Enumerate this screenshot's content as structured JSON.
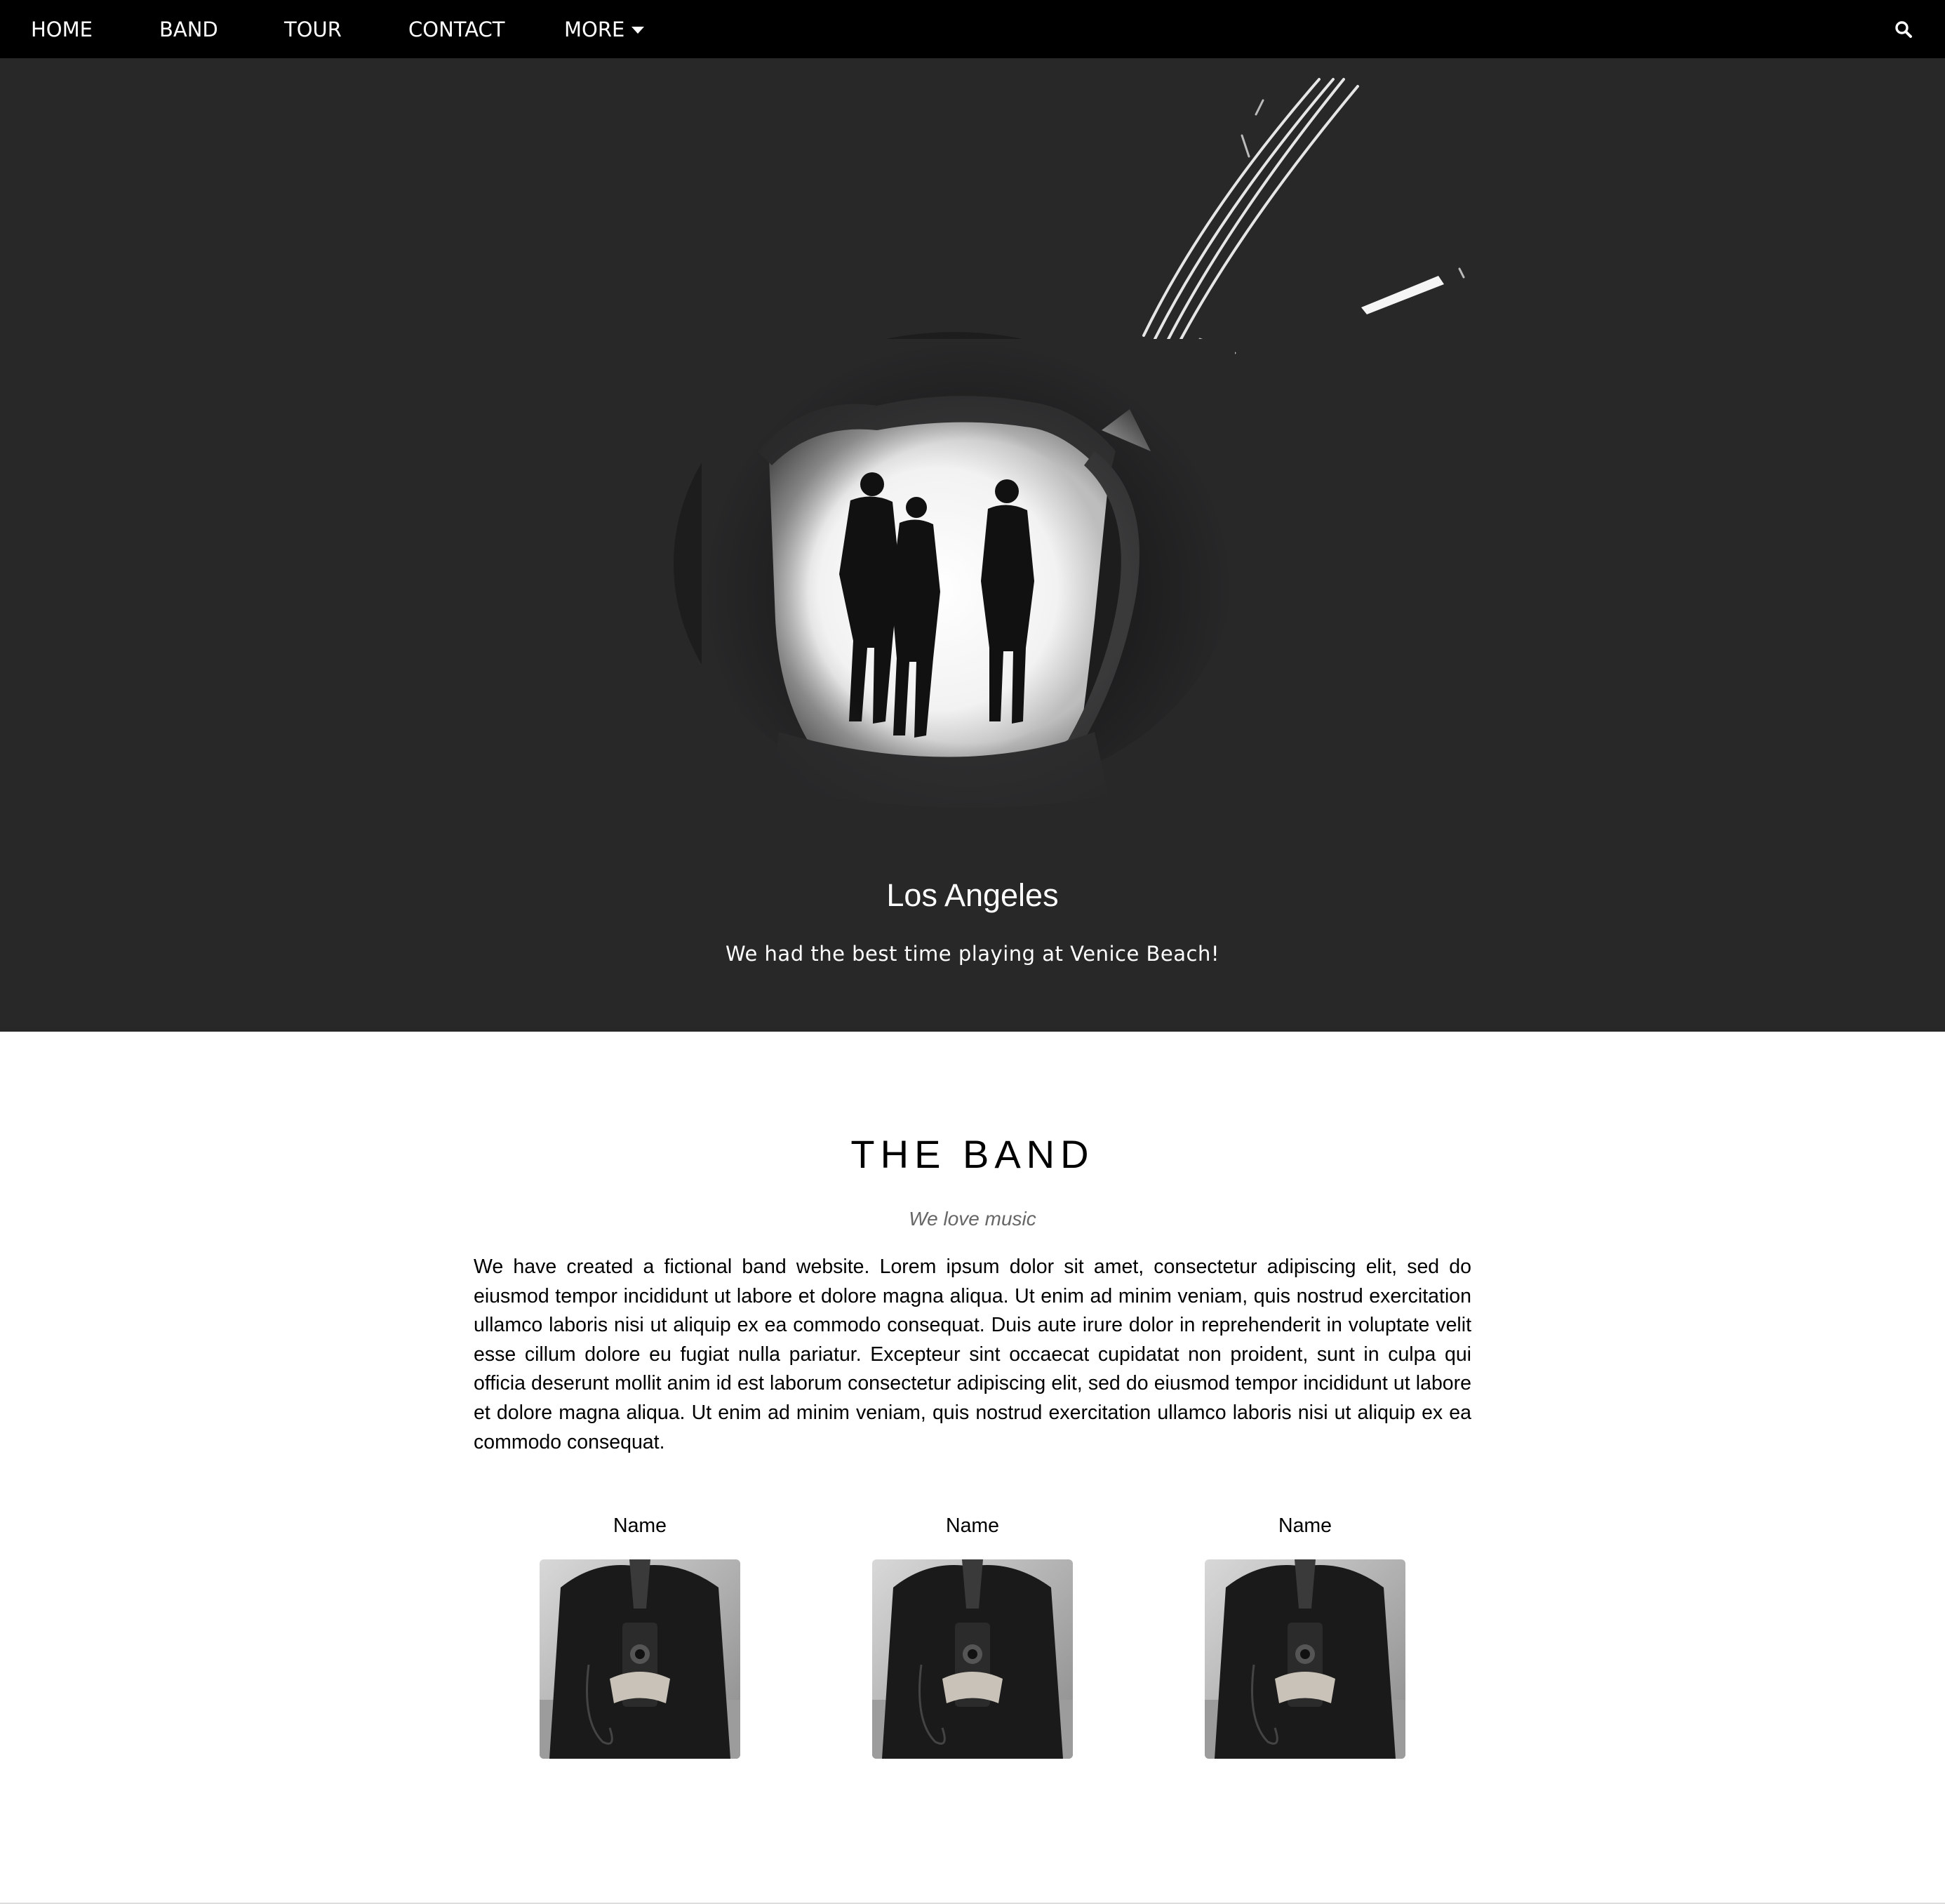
{
  "nav": {
    "items": [
      {
        "label": "HOME"
      },
      {
        "label": "BAND"
      },
      {
        "label": "TOUR"
      },
      {
        "label": "CONTACT"
      },
      {
        "label": "MORE"
      }
    ],
    "search_icon": "search-icon"
  },
  "hero": {
    "title": "Los Angeles",
    "text": "We had the best time playing at Venice Beach!"
  },
  "band": {
    "title": "THE BAND",
    "subtitle": "We love music",
    "text": "We have created a fictional band website. Lorem ipsum dolor sit amet, consectetur adipiscing elit, sed do eiusmod tempor incididunt ut labore et dolore magna aliqua. Ut enim ad minim veniam, quis nostrud exercitation ullamco laboris nisi ut aliquip ex ea commodo consequat. Duis aute irure dolor in reprehenderit in voluptate velit esse cillum dolore eu fugiat nulla pariatur. Excepteur sint occaecat cupidatat non proident, sunt in culpa qui officia deserunt mollit anim id est laborum consectetur adipiscing elit, sed do eiusmod tempor incididunt ut labore et dolore magna aliqua. Ut enim ad minim veniam, quis nostrud exercitation ullamco laboris nisi ut aliquip ex ea commodo consequat.",
    "members": [
      {
        "name": "Name"
      },
      {
        "name": "Name"
      },
      {
        "name": "Name"
      }
    ]
  },
  "colors": {
    "navbar": "#000000",
    "hero_bg": "#282829",
    "subtitle": "#666666"
  }
}
